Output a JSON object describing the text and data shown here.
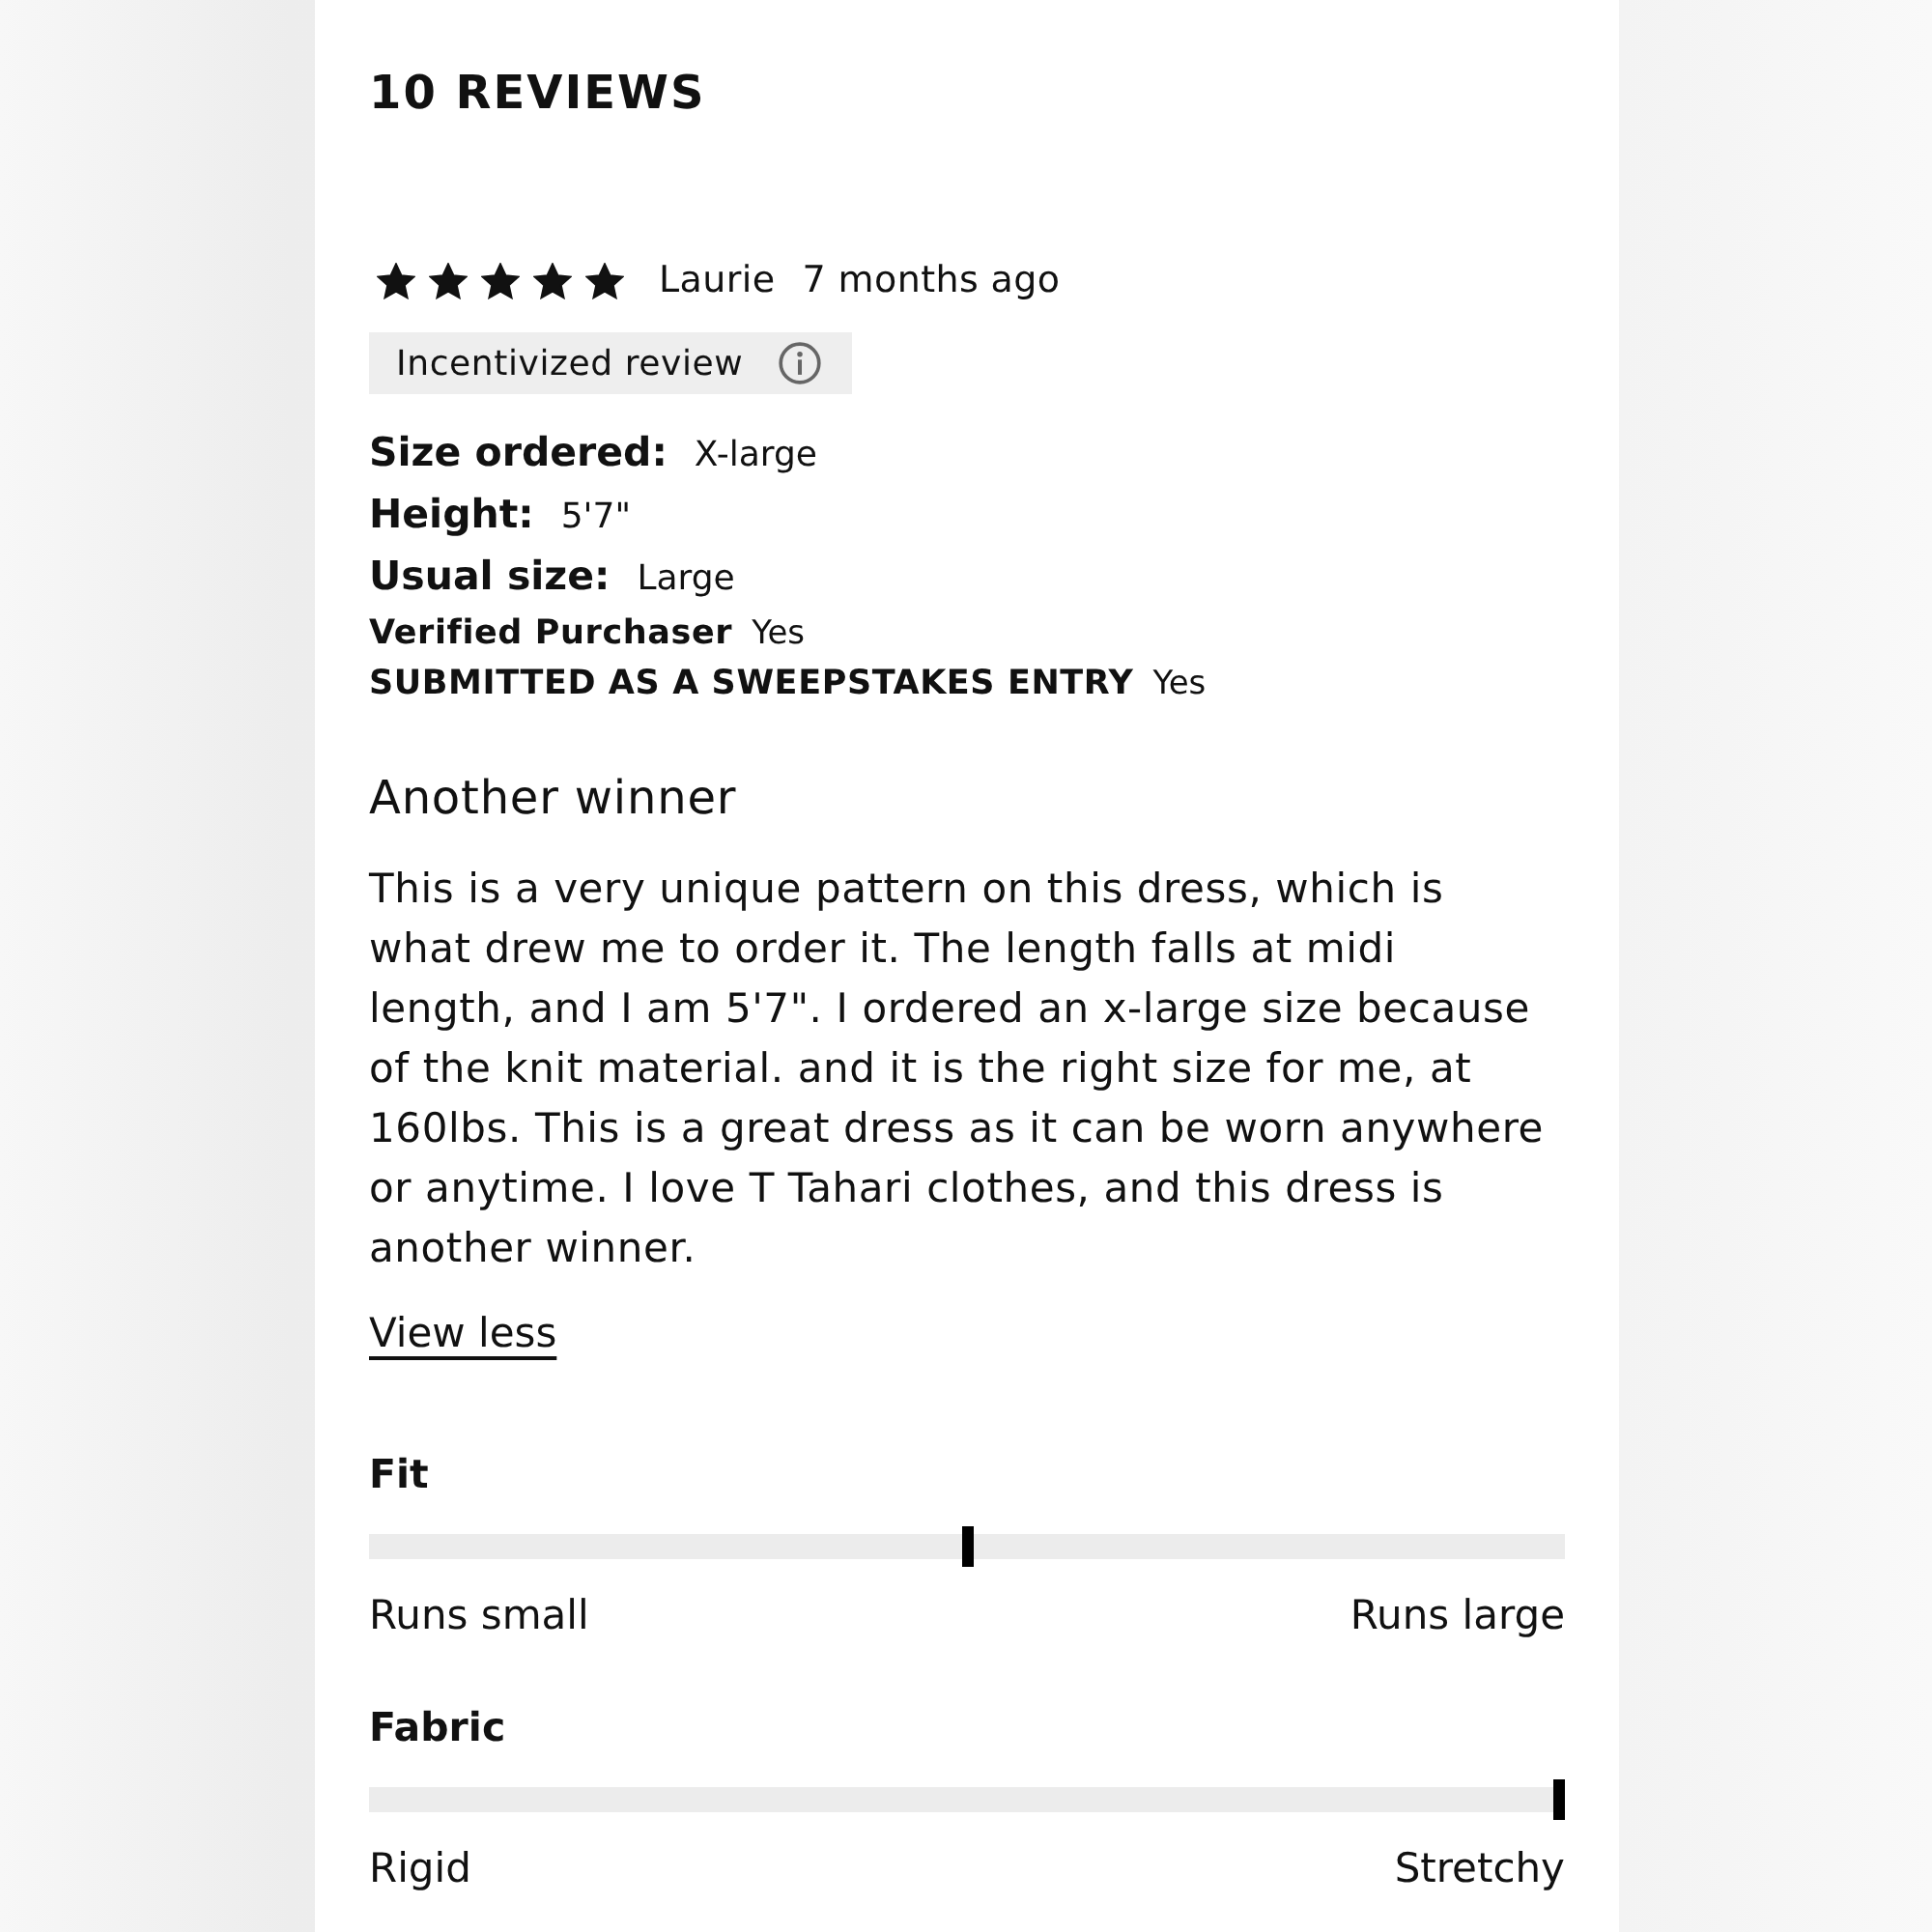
{
  "header": {
    "title": "10 REVIEWS"
  },
  "review": {
    "stars": 5,
    "author": "Laurie",
    "time": "7 months ago",
    "badge": {
      "label": "Incentivized review"
    },
    "details": [
      {
        "kind": "primary",
        "label": "Size ordered:",
        "value": "X-large"
      },
      {
        "kind": "primary",
        "label": "Height:",
        "value": "5'7\""
      },
      {
        "kind": "primary",
        "label": "Usual size:",
        "value": "Large"
      },
      {
        "kind": "secondary",
        "label": "Verified Purchaser",
        "value": "Yes"
      },
      {
        "kind": "secondary",
        "label": "SUBMITTED AS A SWEEPSTAKES ENTRY",
        "value": "Yes"
      }
    ],
    "title": "Another winner",
    "body": "This is a very unique pattern on this dress, which is what drew me to order it. The length falls at midi length, and I am 5'7\". I ordered an x-large size because of the knit material. and it is the right size for me, at 160lbs. This is a great dress as it can be worn anywhere or anytime. I love T Tahari clothes, and this dress is another winner.",
    "toggle": "View less"
  },
  "ratings": [
    {
      "name": "Fit",
      "level": 0.5,
      "min_label": "Runs small",
      "max_label": "Runs large"
    },
    {
      "name": "Fabric",
      "level": 1,
      "min_label": "Rigid",
      "max_label": "Stretchy"
    }
  ]
}
